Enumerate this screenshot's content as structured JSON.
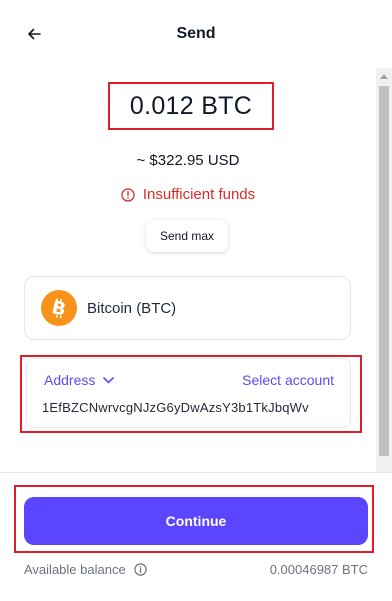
{
  "header": {
    "title": "Send",
    "back_icon": "arrow-left-icon"
  },
  "amount": {
    "value": "0.012 BTC",
    "fiat": "~ $322.95 USD"
  },
  "warning": {
    "text": "Insufficient funds",
    "icon": "alert-circle-icon",
    "color": "#d92b2b"
  },
  "send_max": {
    "label": "Send max"
  },
  "coin": {
    "label": "Bitcoin (BTC)",
    "icon": "bitcoin-icon",
    "color": "#f7931a"
  },
  "address": {
    "type_label": "Address",
    "select_label": "Select account",
    "value": "1EfBZCNwrvcgNJzG6yDwAzsY3b1TkJbqWv"
  },
  "footer": {
    "continue_label": "Continue",
    "balance_label": "Available balance",
    "balance_value": "0.00046987 BTC"
  },
  "colors": {
    "accent": "#5b45ff",
    "link": "#5b4cf0",
    "highlight": "#e11d2a"
  }
}
